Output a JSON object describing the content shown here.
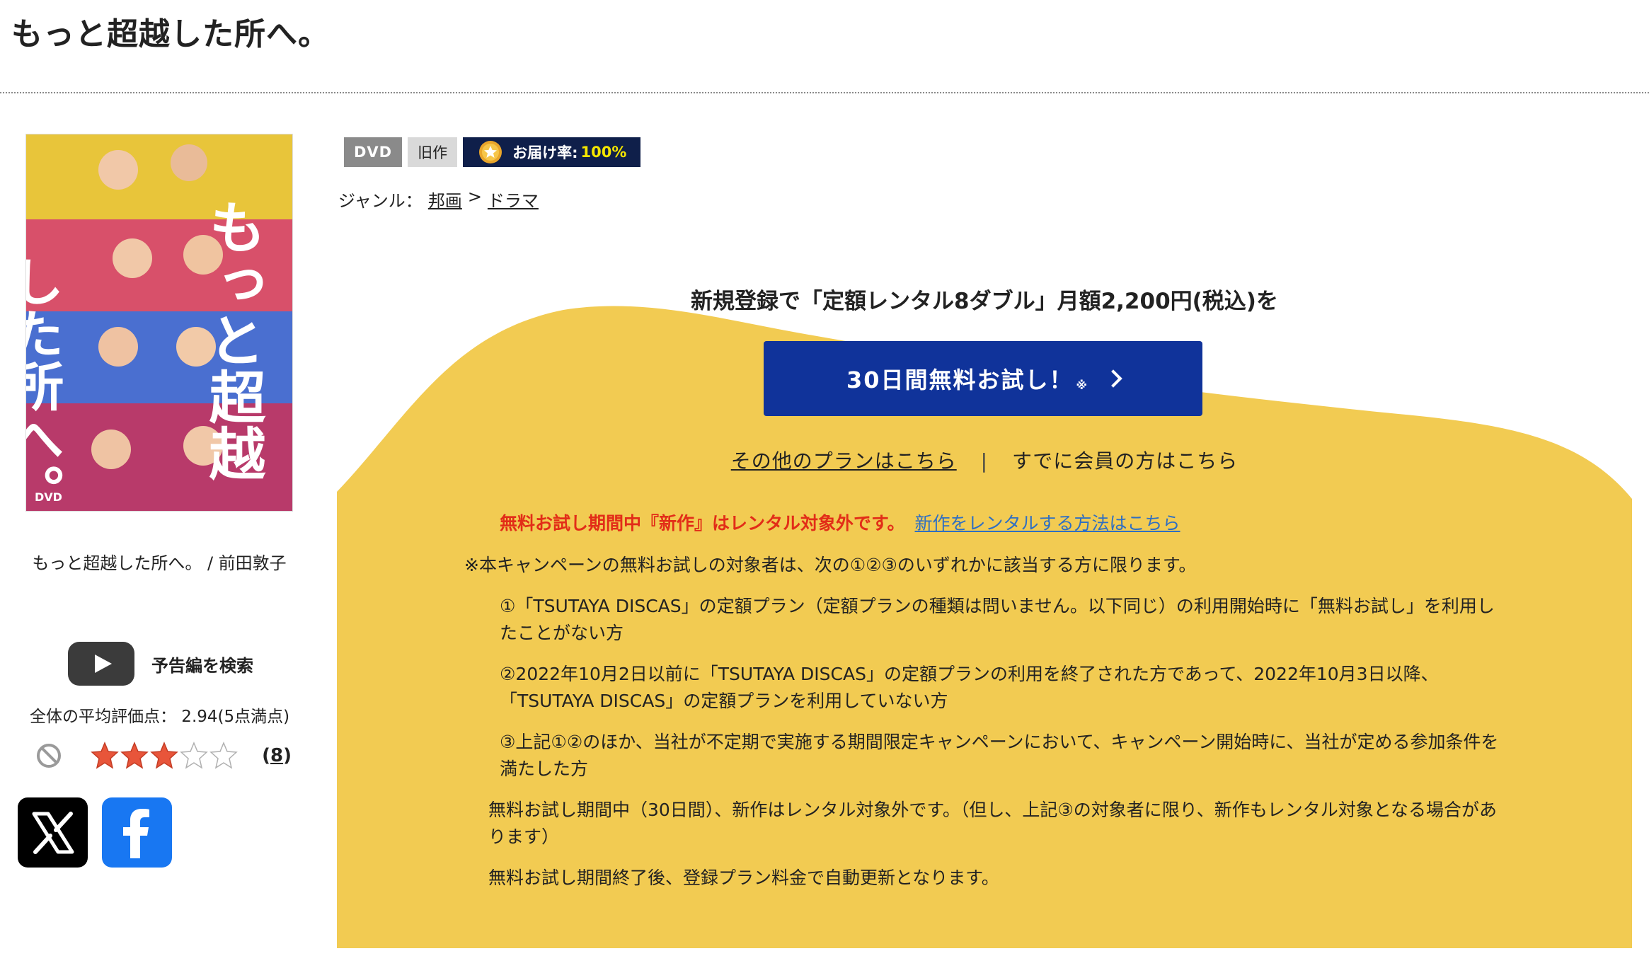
{
  "header": {
    "title": "もっと超越した所へ。"
  },
  "product": {
    "jacket_title_art": "もっと超越した所へ。",
    "jacket_dvd_mark": "DVD",
    "caption": "もっと超越した所へ。 / 前田敦子",
    "trailer_label": "予告編を検索",
    "rating_text": "全体の平均評価点： 2.94(5点満点)",
    "rating_value": 2.94,
    "rating_max": 5,
    "review_count": "8"
  },
  "badges": {
    "format": "DVD",
    "release_type": "旧作",
    "delivery_label": "お届け率:",
    "delivery_value": "100%"
  },
  "genre": {
    "label": "ジャンル：",
    "items": [
      "邦画",
      "ドラマ"
    ],
    "separator": ">"
  },
  "promo": {
    "lead": "新規登録で「定額レンタル8ダブル」月額2,200円(税込)を",
    "cta_label": "30日間無料お試し！",
    "cta_note": "※",
    "other_plans": "その他のプランはこちら",
    "separator": "|",
    "member_link": "すでに会員の方はこちら"
  },
  "notice": {
    "red_text": "無料お試し期間中『新作』はレンタル対象外です。",
    "link_text": "新作をレンタルする方法はこちら"
  },
  "campaign": {
    "intro": "※本キャンペーンの無料お試しの対象者は、次の①②③のいずれかに該当する方に限ります。",
    "conditions": [
      "①「TSUTAYA DISCAS」の定額プラン（定額プランの種類は問いません。以下同じ）の利用開始時に「無料お試し」を利用したことがない方",
      "②2022年10月2日以前に「TSUTAYA DISCAS」の定額プランの利用を終了された方であって、2022年10月3日以降、「TSUTAYA DISCAS」の定額プランを利用していない方",
      "③上記①②のほか、当社が不定期で実施する期間限定キャンペーンにおいて、キャンペーン開始時に、当社が定める参加条件を満たした方"
    ],
    "notes": [
      "無料お試し期間中（30日間）、新作はレンタル対象外です。（但し、上記③の対象者に限り、新作もレンタル対象となる場合があります）",
      "無料お試し期間終了後、登録プラン料金で自動更新となります。"
    ]
  },
  "colors": {
    "yellow": "#f2cb52",
    "cta_blue": "#10339a",
    "badge_navy": "#0f1f4a",
    "notice_red": "#e22d18",
    "link_blue": "#2f6fc2",
    "star_red": "#e8553a"
  },
  "icons": {
    "trailer": "youtube-play-icon",
    "no_rating": "ban-icon",
    "share_x": "x-logo-icon",
    "share_facebook": "facebook-logo-icon",
    "delivery": "star-medal-icon"
  }
}
